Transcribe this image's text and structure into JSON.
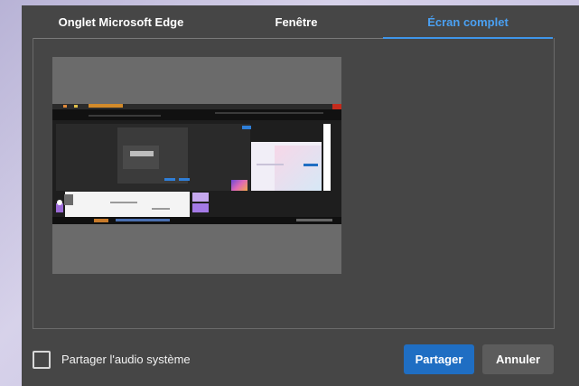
{
  "tabs": [
    {
      "label": "Onglet Microsoft Edge",
      "active": false
    },
    {
      "label": "Fenêtre",
      "active": false
    },
    {
      "label": "Écran complet",
      "active": true
    }
  ],
  "preview": {
    "label": "full-screen-preview"
  },
  "audio": {
    "label": "Partager l'audio système",
    "checked": false
  },
  "buttons": {
    "share": "Partager",
    "cancel": "Annuler"
  },
  "colors": {
    "accent": "#3f95e8",
    "primary_button": "#1f6ec3",
    "dialog_bg": "#464646"
  }
}
